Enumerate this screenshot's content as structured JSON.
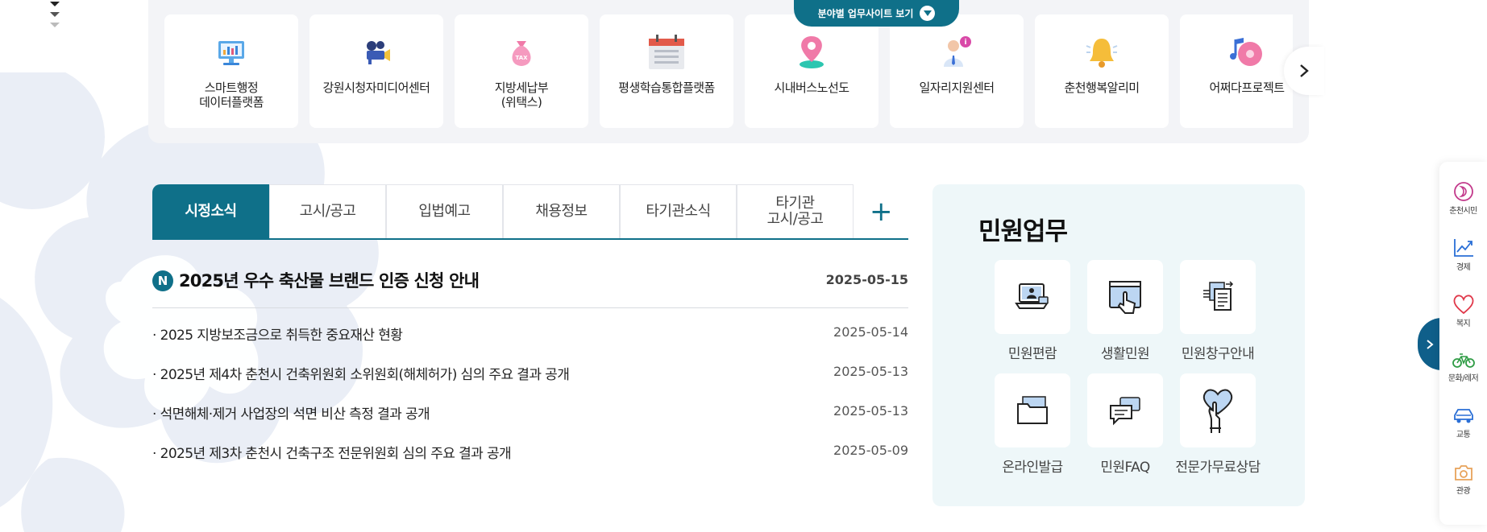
{
  "strip": {
    "toggle_label": "분야별 업무사이트 보기",
    "sites": [
      {
        "label": "스마트행정\n데이터플랫폼",
        "icon": "monitor-chart-icon"
      },
      {
        "label": "강원시청자미디어센터",
        "icon": "video-camera-icon"
      },
      {
        "label": "지방세납부\n(위택스)",
        "icon": "tax-bag-icon"
      },
      {
        "label": "평생학습통합플랫폼",
        "icon": "calendar-icon"
      },
      {
        "label": "시내버스노선도",
        "icon": "location-pin-icon"
      },
      {
        "label": "일자리지원센터",
        "icon": "worker-info-icon"
      },
      {
        "label": "춘천행복알리미",
        "icon": "bell-icon"
      },
      {
        "label": "어쩌다프로젝트",
        "icon": "music-disc-icon"
      }
    ]
  },
  "news": {
    "tabs": [
      {
        "label": "시정소식",
        "active": true
      },
      {
        "label": "고시/공고",
        "active": false
      },
      {
        "label": "입법예고",
        "active": false
      },
      {
        "label": "채용정보",
        "active": false
      },
      {
        "label": "타기관소식",
        "active": false
      },
      {
        "label": "타기관\n고시/공고",
        "active": false
      }
    ],
    "more_label": "+",
    "featured": {
      "badge": "N",
      "title": "2025년 우수 축산물 브랜드 인증 신청 안내",
      "date": "2025-05-15"
    },
    "items": [
      {
        "title": "· 2025 지방보조금으로 취득한 중요재산 현황",
        "date": "2025-05-14"
      },
      {
        "title": "· 2025년 제4차 춘천시 건축위원회 소위원회(해체허가) 심의 주요 결과 공개",
        "date": "2025-05-13"
      },
      {
        "title": "· 석면해체·제거 사업장의 석면 비산 측정 결과 공개",
        "date": "2025-05-13"
      },
      {
        "title": "· 2025년 제3차 춘천시 건축구조 전문위원회 심의 주요 결과 공개",
        "date": "2025-05-09"
      }
    ]
  },
  "civil": {
    "title": "민원업무",
    "items": [
      {
        "label": "민원편람",
        "icon": "laptop-person-icon"
      },
      {
        "label": "생활민원",
        "icon": "touch-screen-icon"
      },
      {
        "label": "민원창구안내",
        "icon": "document-stack-icon"
      },
      {
        "label": "온라인발급",
        "icon": "folder-icon"
      },
      {
        "label": "민원FAQ",
        "icon": "chat-bubbles-icon"
      },
      {
        "label": "전문가무료상담",
        "icon": "heart-hand-icon"
      }
    ]
  },
  "side_menu": {
    "items": [
      {
        "label": "춘천시민",
        "icon": "citizen-icon",
        "color": "#c2388a"
      },
      {
        "label": "경제",
        "icon": "trend-chart-icon",
        "color": "#2a6fd6"
      },
      {
        "label": "복지",
        "icon": "heart-icon",
        "color": "#e0384a"
      },
      {
        "label": "문화/레저",
        "icon": "bicycle-icon",
        "color": "#2f9c45"
      },
      {
        "label": "교통",
        "icon": "car-icon",
        "color": "#2a6fd6"
      },
      {
        "label": "관광",
        "icon": "camera-icon",
        "color": "#e8a25a"
      }
    ]
  },
  "colors": {
    "accent": "#0f7089",
    "civil_bg": "#eef7f9",
    "strip_bg": "#f3f4f7"
  }
}
